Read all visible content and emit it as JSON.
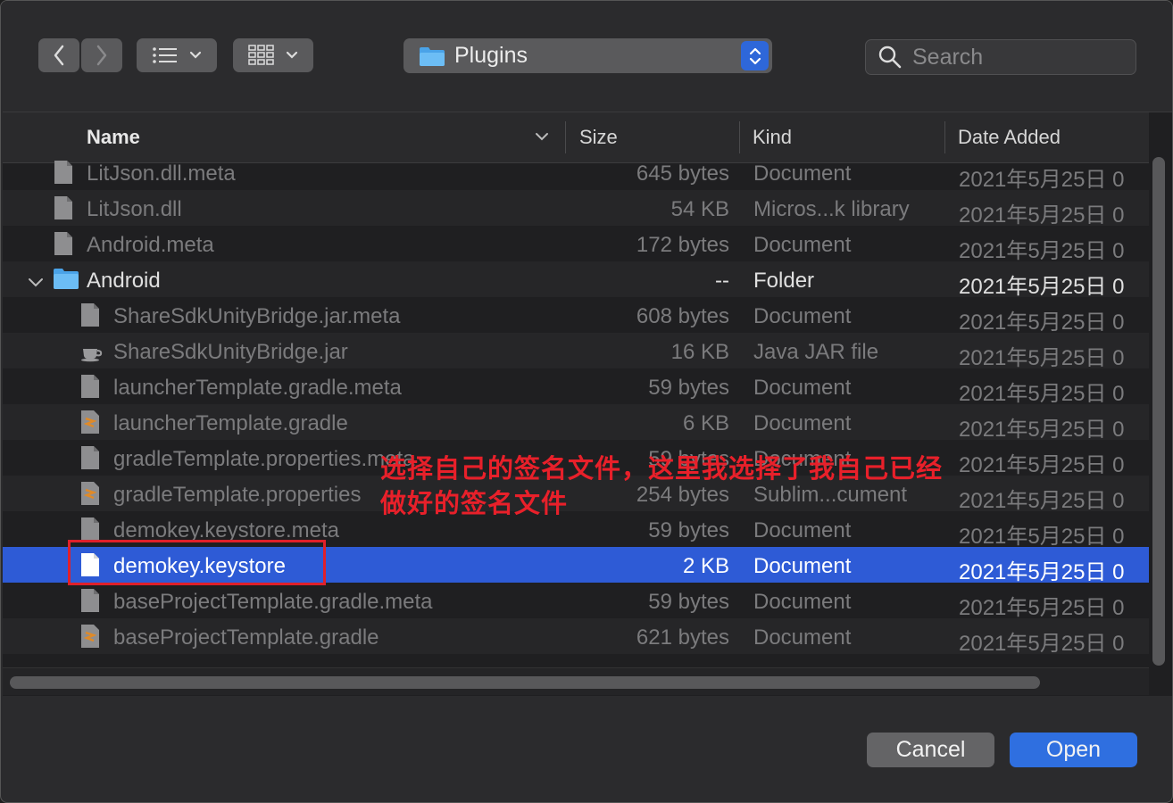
{
  "toolbar": {
    "back_icon": "chevron-left-icon",
    "forward_icon": "chevron-right-icon",
    "list_view_icon": "list-view-icon",
    "icon_view_icon": "grid-view-icon",
    "location": "Plugins",
    "search_placeholder": "Search"
  },
  "columns": {
    "name": "Name",
    "size": "Size",
    "kind": "Kind",
    "date": "Date Added"
  },
  "rows": [
    {
      "name": "LitJson.dll.meta",
      "size": "645 bytes",
      "kind": "Document",
      "date": "2021年5月25日 0",
      "icon": "document-icon",
      "indent": 0
    },
    {
      "name": "LitJson.dll",
      "size": "54 KB",
      "kind": "Micros...k library",
      "date": "2021年5月25日 0",
      "icon": "document-icon",
      "indent": 0
    },
    {
      "name": "Android.meta",
      "size": "172 bytes",
      "kind": "Document",
      "date": "2021年5月25日 0",
      "icon": "document-icon",
      "indent": 0
    },
    {
      "name": "Android",
      "size": "--",
      "kind": "Folder",
      "date": "2021年5月25日 0",
      "icon": "folder-icon",
      "indent": 0
    },
    {
      "name": "ShareSdkUnityBridge.jar.meta",
      "size": "608 bytes",
      "kind": "Document",
      "date": "2021年5月25日 0",
      "icon": "document-icon",
      "indent": 1
    },
    {
      "name": "ShareSdkUnityBridge.jar",
      "size": "16 KB",
      "kind": "Java JAR file",
      "date": "2021年5月25日 0",
      "icon": "java-cup-icon",
      "indent": 1
    },
    {
      "name": "launcherTemplate.gradle.meta",
      "size": "59 bytes",
      "kind": "Document",
      "date": "2021年5月25日 0",
      "icon": "document-icon",
      "indent": 1
    },
    {
      "name": "launcherTemplate.gradle",
      "size": "6 KB",
      "kind": "Document",
      "date": "2021年5月25日 0",
      "icon": "sublime-document-icon",
      "indent": 1
    },
    {
      "name": "gradleTemplate.properties.meta",
      "size": "59 bytes",
      "kind": "Document",
      "date": "2021年5月25日 0",
      "icon": "document-icon",
      "indent": 1
    },
    {
      "name": "gradleTemplate.properties",
      "size": "254 bytes",
      "kind": "Sublim...cument",
      "date": "2021年5月25日 0",
      "icon": "sublime-document-icon",
      "indent": 1
    },
    {
      "name": "demokey.keystore.meta",
      "size": "59 bytes",
      "kind": "Document",
      "date": "2021年5月25日 0",
      "icon": "document-icon",
      "indent": 1
    },
    {
      "name": "demokey.keystore",
      "size": "2 KB",
      "kind": "Document",
      "date": "2021年5月25日 0",
      "icon": "document-icon",
      "indent": 1
    },
    {
      "name": "baseProjectTemplate.gradle.meta",
      "size": "59 bytes",
      "kind": "Document",
      "date": "2021年5月25日 0",
      "icon": "document-icon",
      "indent": 1
    },
    {
      "name": "baseProjectTemplate.gradle",
      "size": "621 bytes",
      "kind": "Document",
      "date": "2021年5月25日 0",
      "icon": "sublime-document-icon",
      "indent": 1
    }
  ],
  "annotation": {
    "line1": "选择自己的签名文件，这里我选择了我自己已经",
    "line2": "做好的签名文件",
    "color": "#e8202a"
  },
  "buttons": {
    "cancel": "Cancel",
    "open": "Open"
  },
  "colors": {
    "accent": "#2e5bd6",
    "open_button": "#2f6fe0"
  }
}
